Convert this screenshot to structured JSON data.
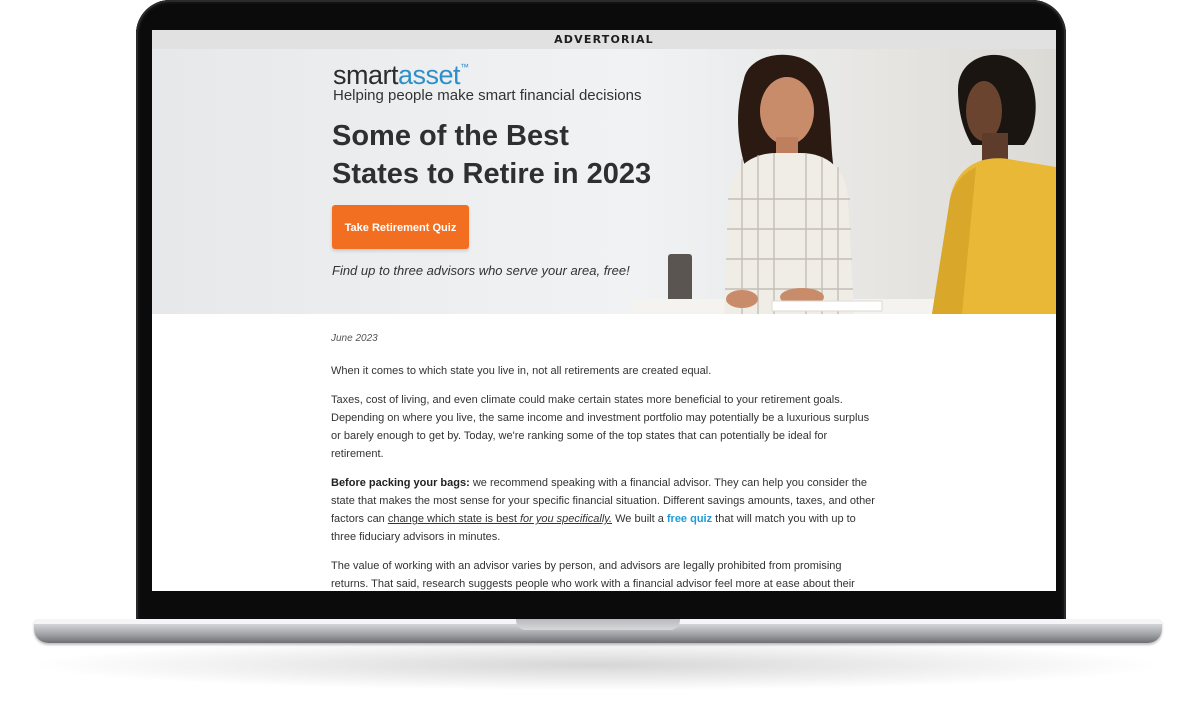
{
  "banner": {
    "label": "ADVERTORIAL"
  },
  "brand": {
    "name_part1": "smart",
    "name_part2": "asset",
    "tm": "™"
  },
  "hero": {
    "tagline": "Helping people make smart financial decisions",
    "headline_line1": "Some of the Best",
    "headline_line2": "States to Retire in 2023",
    "cta_label": "Take Retirement Quiz",
    "subtext": "Find up to three advisors who serve your area, free!"
  },
  "article": {
    "date": "June 2023",
    "p1": "When it comes to which state you live in, not all retirements are created equal.",
    "p2": "Taxes, cost of living, and even climate could make certain states more beneficial to your retirement goals. Depending on where you live, the same income and investment portfolio may potentially be a luxurious surplus or barely enough to get by. Today, we're ranking some of the top states that can potentially be ideal for retirement.",
    "p3_bold": "Before packing your bags:",
    "p3_a": " we recommend speaking with a financial advisor. They can help you consider the state that makes the most sense for your specific financial situation. Different savings amounts, taxes, and other factors can ",
    "p3_underline": "change which state is best ",
    "p3_underline_italic": "for you specifically.",
    "p3_b": " We built a ",
    "p3_link": "free quiz",
    "p3_c": " that will match you with up to three fiduciary advisors in minutes.",
    "p4": "The value of working with an advisor varies by person, and advisors are legally prohibited from promising returns. That said, research suggests people who work with a financial advisor feel more at ease about their"
  },
  "colors": {
    "cta": "#f26f21",
    "link": "#1f9bd7",
    "brand_accent": "#2e8fc8"
  }
}
